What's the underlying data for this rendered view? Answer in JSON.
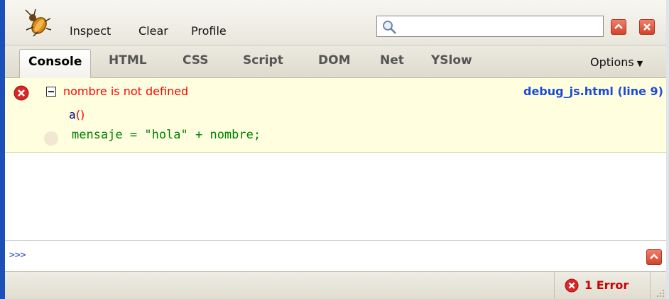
{
  "toolbar": {
    "buttons": [
      "Inspect",
      "Clear",
      "Profile"
    ],
    "search_value": ""
  },
  "tabs": [
    "Console",
    "HTML",
    "CSS",
    "Script",
    "DOM",
    "Net",
    "YSlow"
  ],
  "active_tab": "Console",
  "options_label": "Options",
  "console": {
    "error": {
      "message": "nombre is not defined",
      "source": "debug_js.html (line 9)",
      "stack_function": "a",
      "stack_parens": "()",
      "source_line": "mensaje = \"hola\" + nombre;"
    }
  },
  "command_line": {
    "prompt": ">>>",
    "value": ""
  },
  "status": {
    "error_count_label": "1 Error"
  },
  "colors": {
    "error_text": "#ff0000",
    "link": "#1c4ad6",
    "code": "#008000",
    "error_bg": "#ffffe0",
    "frame": "#1d4fb8"
  }
}
